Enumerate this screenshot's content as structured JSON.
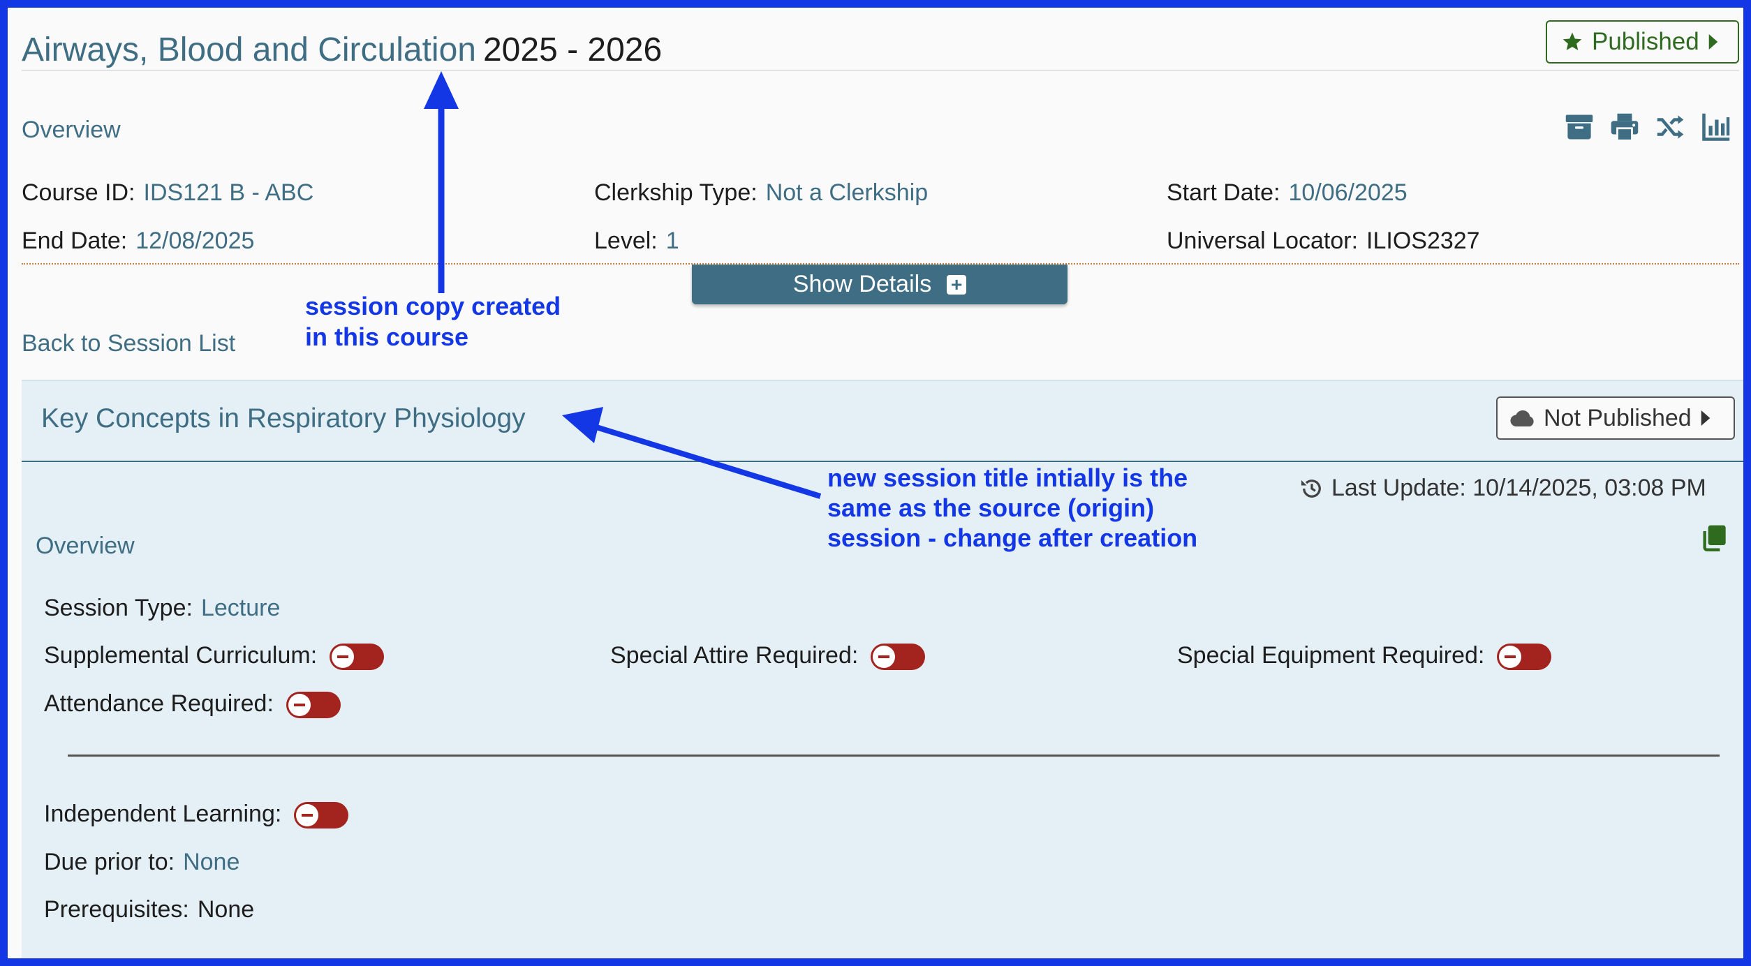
{
  "course": {
    "title": "Airways, Blood and Circulation",
    "year": "2025 - 2026",
    "publish_status": "Published",
    "overview_label": "Overview",
    "fields": {
      "course_id_label": "Course ID:",
      "course_id": "IDS121 B - ABC",
      "clerkship_type_label": "Clerkship Type:",
      "clerkship_type": "Not a Clerkship",
      "start_date_label": "Start Date:",
      "start_date": "10/06/2025",
      "end_date_label": "End Date:",
      "end_date": "12/08/2025",
      "level_label": "Level:",
      "level": "1",
      "universal_locator_label": "Universal Locator:",
      "universal_locator": "ILIOS2327"
    },
    "show_details_label": "Show Details",
    "back_link": "Back to Session List",
    "tool_icons": [
      "archive-icon",
      "print-icon",
      "shuffle-icon",
      "chart-icon"
    ]
  },
  "session": {
    "title": "Key Concepts in Respiratory Physiology",
    "publish_status": "Not Published",
    "last_update": "Last Update: 10/14/2025, 03:08 PM",
    "overview_label": "Overview",
    "session_type_label": "Session Type:",
    "session_type": "Lecture",
    "supplemental_label": "Supplemental Curriculum:",
    "attire_label": "Special Attire Required:",
    "equipment_label": "Special Equipment Required:",
    "attendance_label": "Attendance Required:",
    "independent_label": "Independent Learning:",
    "due_prior_label": "Due prior to:",
    "due_prior": "None",
    "prereq_label": "Prerequisites:",
    "prereq": "None",
    "toggles": {
      "supplemental": false,
      "attire": false,
      "equipment": false,
      "attendance": false,
      "independent": false
    }
  },
  "annotations": {
    "course_note_line1": "session copy created",
    "course_note_line2": "in this course",
    "title_note_line1": "new session title intially is the",
    "title_note_line2": "same as the source (origin)",
    "title_note_line3": "session - change after creation"
  },
  "colors": {
    "accent": "#3f6e84",
    "published_green": "#2e6b1f",
    "toggle_off_red": "#a3231e",
    "annotation_blue": "#1437e6",
    "frame_blue": "#1437e6"
  }
}
